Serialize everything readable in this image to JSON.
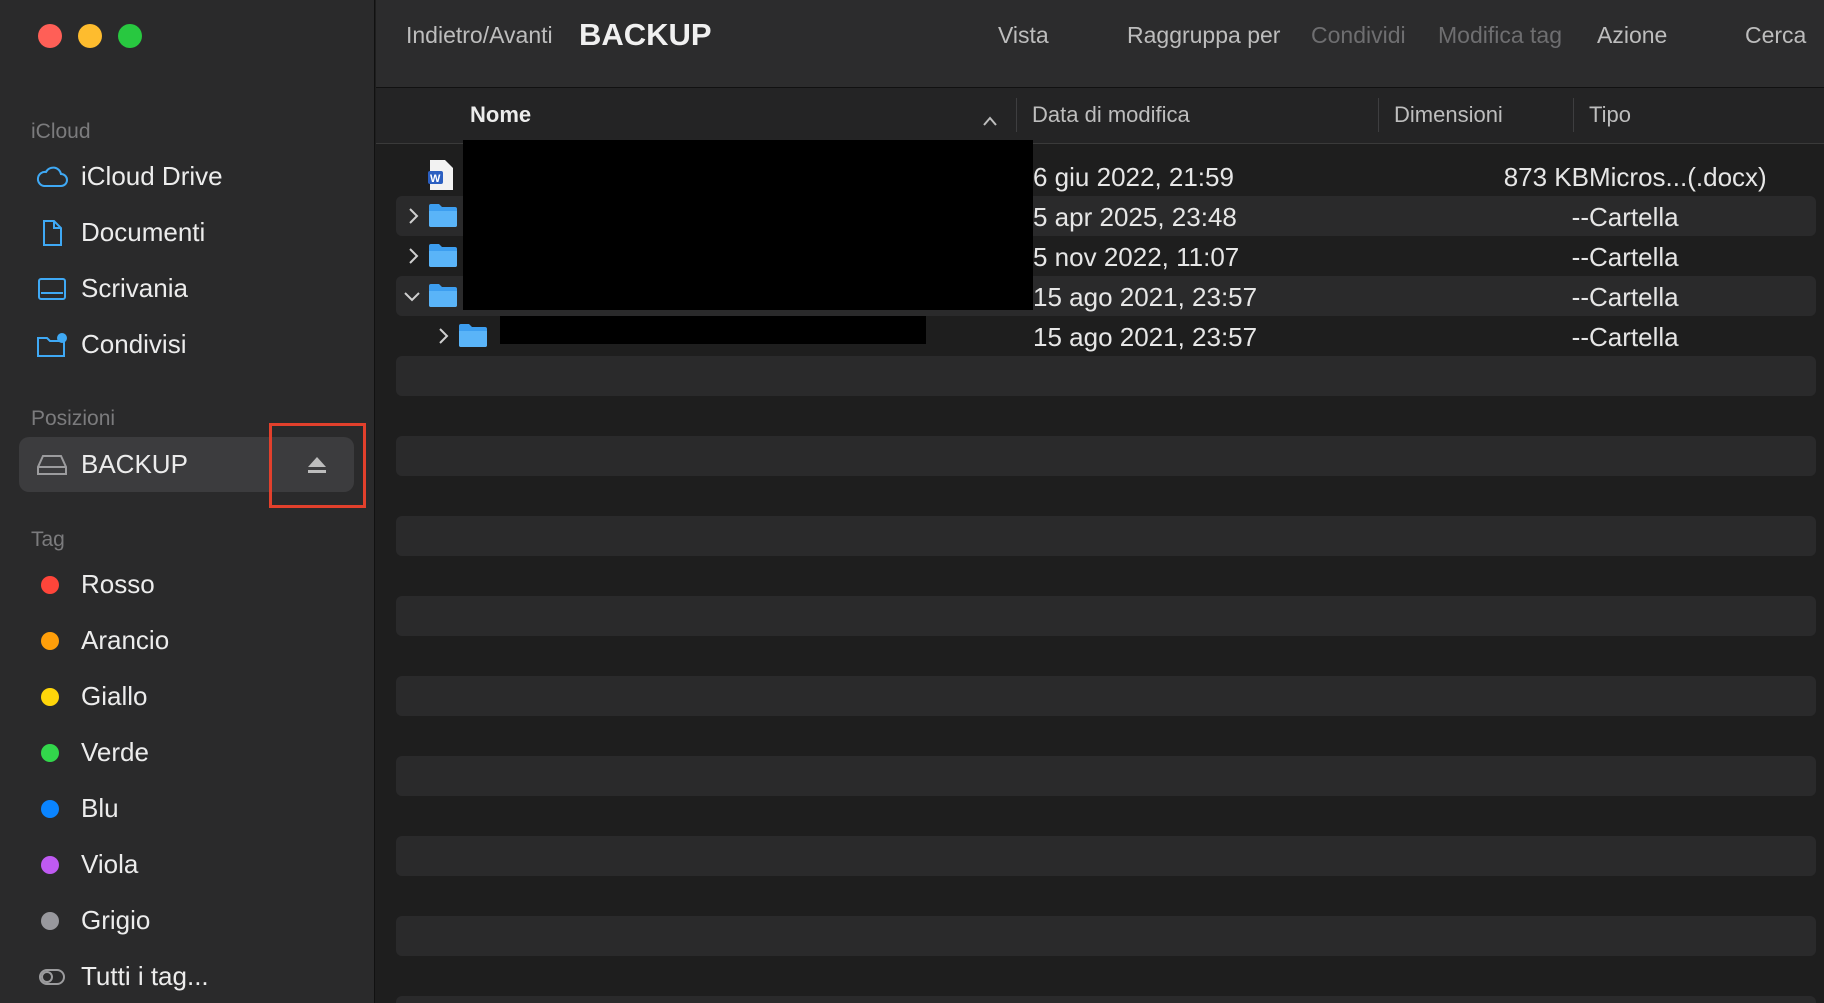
{
  "window": {
    "traffic_lights": {
      "close": "#ff5f57",
      "minimize": "#febc2e",
      "zoom": "#28c840"
    }
  },
  "toolbar": {
    "nav_label": "Indietro/Avanti",
    "title": "BACKUP",
    "view_label": "Vista",
    "group_label": "Raggruppa per",
    "share_label": "Condividi",
    "edit_tags_label": "Modifica tag",
    "action_label": "Azione",
    "search_label": "Cerca"
  },
  "sidebar": {
    "icloud_title": "iCloud",
    "icloud_items": [
      {
        "label": "iCloud Drive",
        "icon": "cloud-icon"
      },
      {
        "label": "Documenti",
        "icon": "document-icon"
      },
      {
        "label": "Scrivania",
        "icon": "desktop-icon"
      },
      {
        "label": "Condivisi",
        "icon": "shared-folder-icon"
      }
    ],
    "locations_title": "Posizioni",
    "location": {
      "label": "BACKUP",
      "icon": "drive-icon",
      "eject_icon": "eject-icon",
      "highlight_color": "#e2402c"
    },
    "tags_title": "Tag",
    "tags": [
      {
        "label": "Rosso",
        "color": "#ff453a"
      },
      {
        "label": "Arancio",
        "color": "#ff9f0a"
      },
      {
        "label": "Giallo",
        "color": "#ffd60a"
      },
      {
        "label": "Verde",
        "color": "#32d74b"
      },
      {
        "label": "Blu",
        "color": "#0a84ff"
      },
      {
        "label": "Viola",
        "color": "#bf5af2"
      },
      {
        "label": "Grigio",
        "color": "#98989d"
      }
    ],
    "all_tags_label": "Tutti i tag..."
  },
  "columns": {
    "name": "Nome",
    "modified": "Data di modifica",
    "size": "Dimensioni",
    "kind": "Tipo"
  },
  "files": [
    {
      "date": "6 giu 2022, 21:59",
      "size": "873 KB",
      "kind": "Micros...(.docx)",
      "icon": "word-document-icon"
    },
    {
      "date": "5 apr 2025, 23:48",
      "size": "--",
      "kind": "Cartella",
      "icon": "folder-icon",
      "disclosure": "collapsed"
    },
    {
      "date": "5 nov 2022, 11:07",
      "size": "--",
      "kind": "Cartella",
      "icon": "folder-icon",
      "disclosure": "collapsed"
    },
    {
      "date": "15 ago 2021, 23:57",
      "size": "--",
      "kind": "Cartella",
      "icon": "folder-icon",
      "disclosure": "expanded"
    },
    {
      "date": "15 ago 2021, 23:57",
      "size": "--",
      "kind": "Cartella",
      "icon": "folder-icon",
      "disclosure": "collapsed"
    }
  ]
}
